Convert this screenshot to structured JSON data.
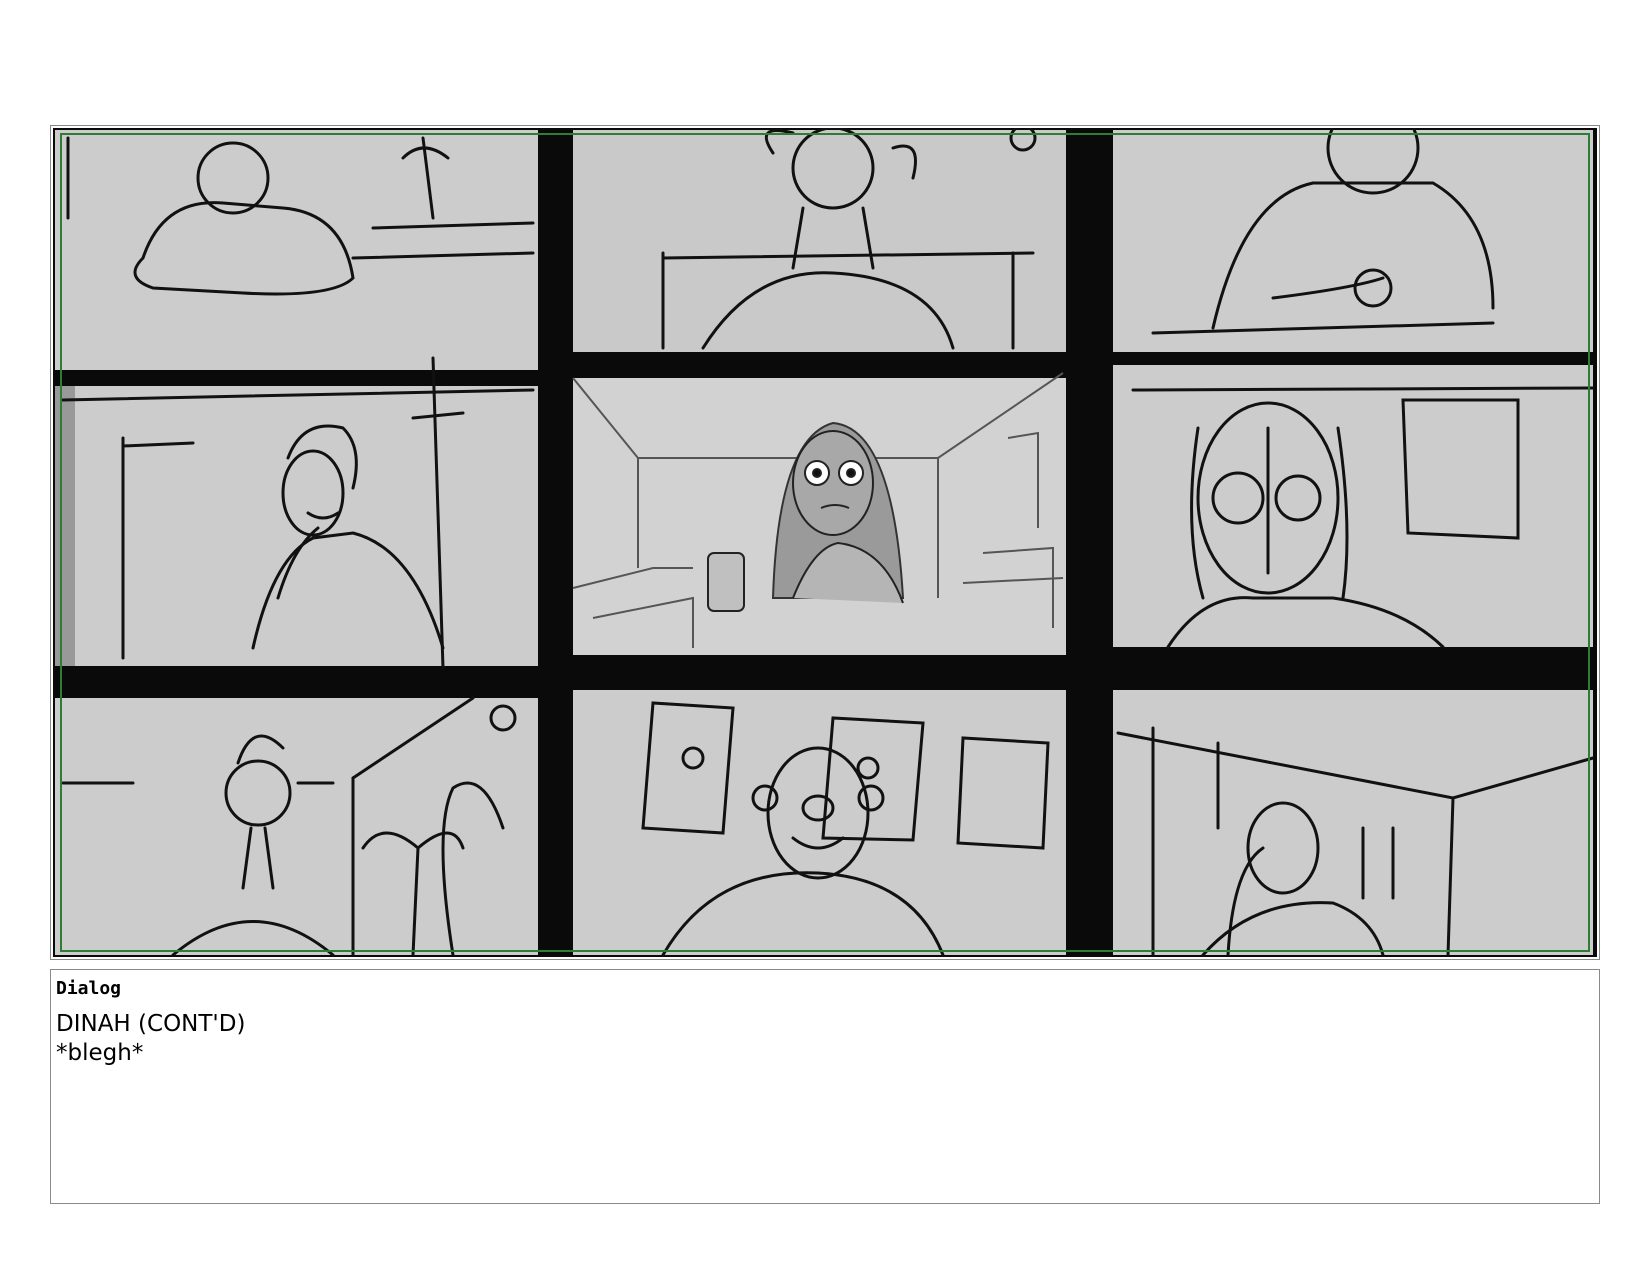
{
  "panel": {
    "image": "storyboard sketch: 3x3 video call grid with nine participants",
    "colors": {
      "tile_fill": "#cccccc",
      "gutter": "#0a0a0a",
      "safe_frame": "#2e7d32",
      "border": "#8a8a8a"
    }
  },
  "dialog": {
    "label": "Dialog",
    "lines": "DINAH (CONT'D)\n*blegh*"
  }
}
